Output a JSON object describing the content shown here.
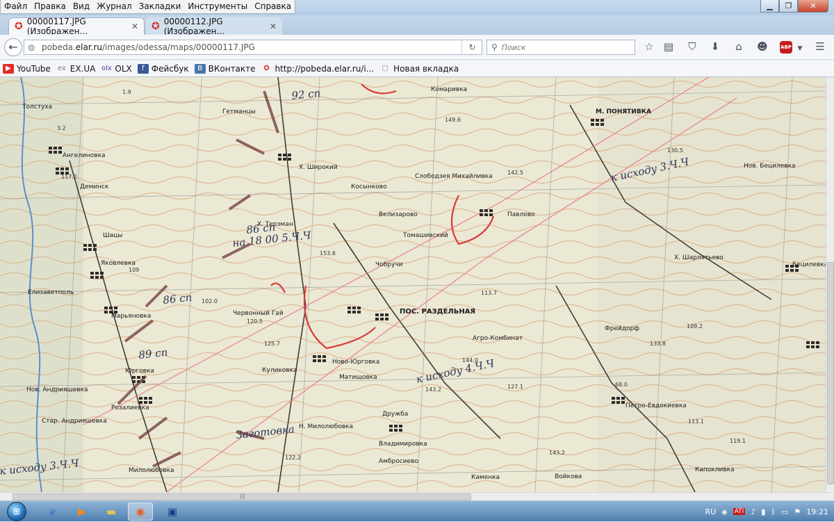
{
  "menu": [
    "Файл",
    "Правка",
    "Вид",
    "Журнал",
    "Закладки",
    "Инструменты",
    "Справка"
  ],
  "tabs": [
    {
      "title": "00000117.JPG (Изображен...",
      "active": true
    },
    {
      "title": "00000112.JPG (Изображен...",
      "active": false
    }
  ],
  "address": {
    "url_prefix": "pobeda.",
    "url_domain": "elar.ru",
    "url_suffix": "/images/odessa/maps/00000117.JPG"
  },
  "search": {
    "placeholder": "Поиск"
  },
  "bookmarks": [
    {
      "label": "YouTube",
      "icon": "youtube-icon",
      "color": "#e52d27"
    },
    {
      "label": "EX.UA",
      "icon": "exua-icon",
      "color": "#7a7a7a"
    },
    {
      "label": "OLX",
      "icon": "olx-icon",
      "color": "#5b2d91"
    },
    {
      "label": "Фейсбук",
      "icon": "facebook-icon",
      "color": "#3b5998"
    },
    {
      "label": "ВКонтакте",
      "icon": "vk-icon",
      "color": "#4a76a8"
    },
    {
      "label": "http://pobeda.elar.ru/i...",
      "icon": "star-icon",
      "color": "#d52b2b"
    },
    {
      "label": "Новая вкладка",
      "icon": "page-icon",
      "color": "#888888"
    }
  ],
  "map": {
    "places": [
      "Толстуха",
      "Ангелиновка",
      "Деминск",
      "Шацы",
      "Яковлевка",
      "Елизаветполь",
      "Марьяновка",
      "Юрговка",
      "Нов. Андрияшевка",
      "Стар. Андрияшевка",
      "Розалиевка",
      "Милолюбовка",
      "Гетманцы",
      "Х. Широкий",
      "Х. Терзман",
      "Червонный Гай",
      "Косынково",
      "Слободзея Михайливка",
      "Велизарово",
      "Томашивский",
      "Чобручи",
      "ПОС. РАЗДЕЛЬНАЯ",
      "Ново-Юрговка",
      "Куликовка",
      "Матищовка",
      "Н. Милолюбовка",
      "Дружба",
      "Владимировка",
      "Амбросиево",
      "Каменка",
      "Войкова",
      "Агро-Комбинат",
      "Фрейдорф",
      "Петро-Евдокиевка",
      "Капокливка",
      "Нов. Бецилевка",
      "Х. Шарлятьево",
      "М. ПОНЯТИВКА",
      "Комаривка",
      "Бецилевка",
      "Павлово"
    ],
    "annotations": [
      "92 сп",
      "86 сп",
      "89 сп",
      "86 сп",
      "к исходу 3.Ч.Ч",
      "к исходу 4.Ч.Ч",
      "к исходу 3.Ч.Ч",
      "на 18 00 5.Ч.Ч",
      "Заготовка"
    ],
    "elevations": [
      "1.9",
      "3.2",
      "117.2",
      "109",
      "102.0",
      "120.5",
      "125.7",
      "153.6",
      "113.7",
      "142.5",
      "149.6",
      "130.5",
      "109.2",
      "133.8",
      "144.0",
      "143.2",
      "127.1",
      "113.1",
      "119.1",
      "143.2",
      "122.2",
      "68.0"
    ]
  },
  "taskbar": {
    "apps": [
      "internet-explorer-icon",
      "media-player-icon",
      "folder-icon",
      "firefox-icon",
      "save-icon"
    ],
    "lang": "RU",
    "time": "19:21"
  }
}
